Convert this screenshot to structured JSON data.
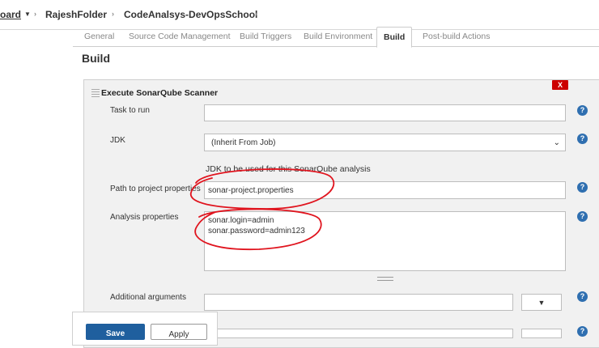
{
  "breadcrumb": {
    "items": [
      "oard",
      "RajeshFolder",
      "CodeAnalsys-DevOpsSchool"
    ]
  },
  "tabs": [
    {
      "label": "General"
    },
    {
      "label": "Source Code Management"
    },
    {
      "label": "Build Triggers"
    },
    {
      "label": "Build Environment"
    },
    {
      "label": "Build"
    },
    {
      "label": "Post-build Actions"
    }
  ],
  "section_title": "Build",
  "builder": {
    "title": "Execute SonarQube Scanner",
    "delete_label": "X",
    "task_label": "Task to run",
    "task_value": "",
    "jdk_label": "JDK",
    "jdk_selected": "(Inherit From Job)",
    "jdk_hint": "JDK to be used for this SonarQube analysis",
    "path_label": "Path to project properties",
    "path_value": "sonar-project.properties",
    "analysis_label": "Analysis properties",
    "analysis_value": "sonar.login=admin\nsonar.password=admin123",
    "additional_label": "Additional arguments",
    "additional_value": ""
  },
  "help_label": "?",
  "dropdown_arrow": "▼",
  "footer": {
    "save_label": "Save",
    "apply_label": "Apply"
  },
  "colors": {
    "help": "#2f6fb0",
    "delete": "#cc0000",
    "annotation": "#e0141e",
    "save": "#1f5f9e"
  }
}
